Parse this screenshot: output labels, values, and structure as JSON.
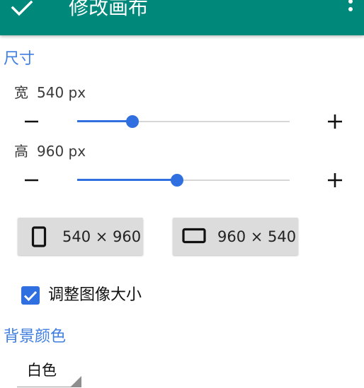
{
  "app_bar": {
    "title": "修改画布",
    "background": "#00897b",
    "confirm_icon": "check-icon",
    "menu_icon": "more-vert-icon"
  },
  "size_section": {
    "header": "尺寸",
    "width": {
      "label": "宽",
      "value": "540 px",
      "slider_fraction": 0.26,
      "decrease_icon": "minus-icon",
      "increase_icon": "plus-icon"
    },
    "height": {
      "label": "高",
      "value": "960 px",
      "slider_fraction": 0.47,
      "decrease_icon": "minus-icon",
      "increase_icon": "plus-icon"
    }
  },
  "presets": [
    {
      "label": "540 × 960",
      "icon": "portrait-icon"
    },
    {
      "label": "960 × 540",
      "icon": "landscape-icon"
    }
  ],
  "resize_image": {
    "label": "调整图像大小",
    "checked": true
  },
  "background_section": {
    "header": "背景颜色",
    "selected": "白色"
  },
  "accent_color": "#2f6fe0"
}
